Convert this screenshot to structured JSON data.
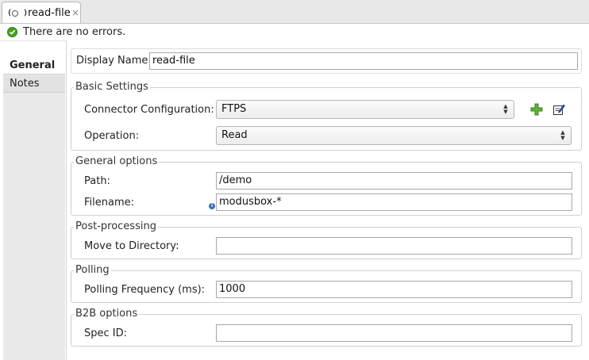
{
  "tab": {
    "title": "read-file",
    "close_glyph": "×",
    "icon_name": "ftps-connector-icon"
  },
  "status": {
    "message": "There are no errors.",
    "icon_name": "check-circle-icon",
    "color": "#4aa21e"
  },
  "nav": {
    "items": [
      {
        "label": "General",
        "selected": true
      },
      {
        "label": "Notes",
        "selected": false
      }
    ]
  },
  "form": {
    "display_name": {
      "label": "Display Name:",
      "value": "read-file"
    },
    "basic_settings": {
      "title": "Basic Settings",
      "connector_config": {
        "label": "Connector Configuration:",
        "value": "FTPS"
      },
      "operation": {
        "label": "Operation:",
        "value": "Read"
      },
      "add_icon": "add-icon",
      "edit_icon": "edit-icon"
    },
    "general_options": {
      "title": "General options",
      "path": {
        "label": "Path:",
        "value": "/demo"
      },
      "filename": {
        "label": "Filename:",
        "value": "modusbox-*"
      },
      "info_icon": "info-icon"
    },
    "post_processing": {
      "title": "Post-processing",
      "move_to_directory": {
        "label": "Move to Directory:",
        "value": ""
      }
    },
    "polling": {
      "title": "Polling",
      "frequency": {
        "label": "Polling Frequency (ms):",
        "value": "1000"
      }
    },
    "b2b": {
      "title": "B2B options",
      "spec_id": {
        "label": "Spec ID:",
        "value": ""
      }
    }
  }
}
